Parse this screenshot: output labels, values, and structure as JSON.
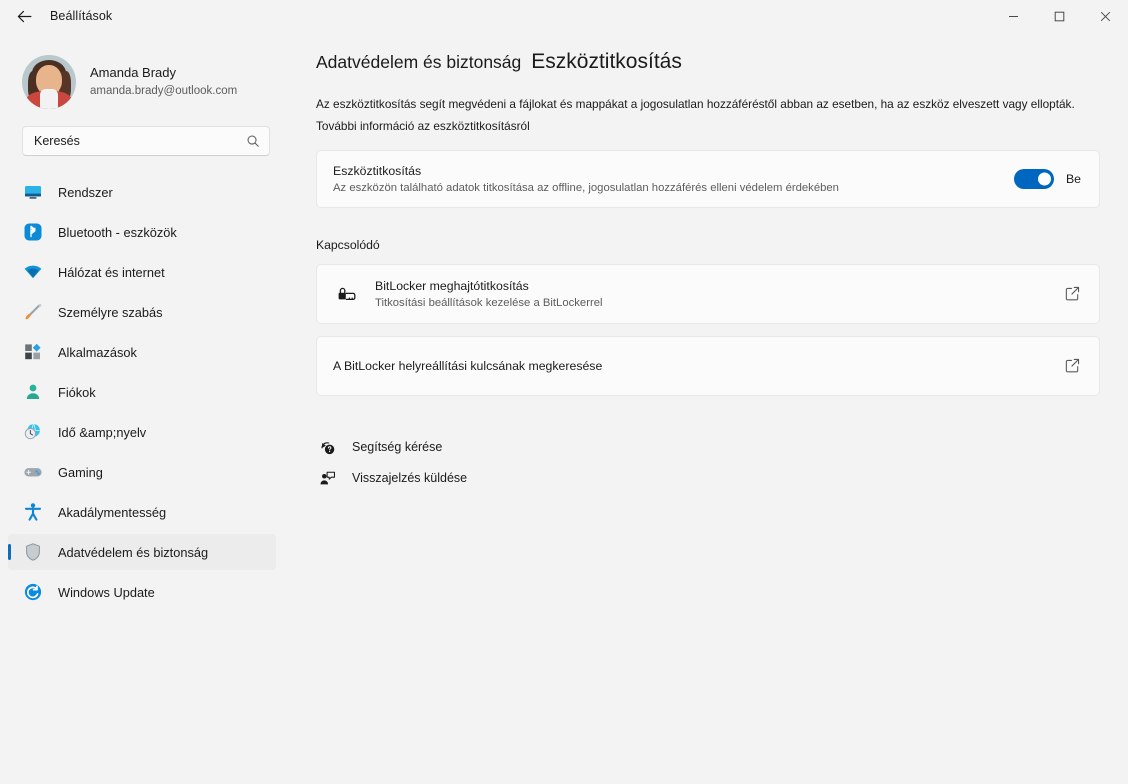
{
  "window": {
    "title": "Beállítások",
    "back_icon": "back-arrow-icon",
    "minimize_label": "–",
    "maximize_label": "□",
    "close_label": "✕"
  },
  "account": {
    "name": "Amanda Brady",
    "email": "amanda.brady@outlook.com",
    "avatar_icon": "user-avatar-photo"
  },
  "search": {
    "placeholder": "Keresés",
    "value": "",
    "icon": "search-icon"
  },
  "sidebar": {
    "items": [
      {
        "label": "Rendszer",
        "icon": "monitor-icon",
        "selected": false
      },
      {
        "label": "Bluetooth - eszközök",
        "icon": "bluetooth-icon",
        "selected": false
      },
      {
        "label": "Hálózat és internet",
        "icon": "wifi-icon",
        "selected": false
      },
      {
        "label": "Személyre szabás",
        "icon": "paintbrush-icon",
        "selected": false
      },
      {
        "label": "Alkalmazások",
        "icon": "apps-icon",
        "selected": false
      },
      {
        "label": "Fiókok",
        "icon": "accounts-person-icon",
        "selected": false
      },
      {
        "label": "Idő &amp;nyelv",
        "icon": "clock-globe-icon",
        "selected": false
      },
      {
        "label": "Gaming",
        "icon": "gamepad-icon",
        "selected": false
      },
      {
        "label": "Akadálymentesség",
        "icon": "accessibility-icon",
        "selected": false
      },
      {
        "label": "Adatvédelem és biztonság",
        "icon": "shield-icon",
        "selected": true
      },
      {
        "label": "Windows Update",
        "icon": "update-refresh-icon",
        "selected": false
      }
    ]
  },
  "main": {
    "breadcrumb_parent": "Adatvédelem és biztonság",
    "breadcrumb_current": "Eszköztitkosítás",
    "description": "Az eszköztitkosítás segít megvédeni a fájlokat és mappákat a jogosulatlan hozzáféréstől abban az esetben, ha az eszköz elveszett vagy ellopták. További információ az eszköztitkosításról",
    "device_encryption": {
      "title": "Eszköztitkosítás",
      "subtitle": "Az eszközön található adatok titkosítása az offline, jogosulatlan hozzáférés elleni védelem érdekében",
      "toggle_state_label": "Be",
      "toggle_on": true,
      "toggle_color": "#0067c0"
    },
    "related_label": "Kapcsolódó",
    "related_items": [
      {
        "title": "BitLocker meghajtótitkosítás",
        "subtitle": "Titkosítási beállítások kezelése a BitLockerrel",
        "icon": "bitlocker-drive-lock-icon",
        "action_icon": "external-link-icon"
      },
      {
        "title": "A BitLocker helyreállítási kulcsának megkeresése",
        "subtitle": "",
        "icon": "",
        "action_icon": "external-link-icon"
      }
    ],
    "footer_links": [
      {
        "label": "Segítség kérése",
        "icon": "help-question-icon"
      },
      {
        "label": "Visszajelzés küldése",
        "icon": "feedback-icon"
      }
    ]
  },
  "theme": {
    "accent": "#0067c0",
    "selection_bar": "#0f6cbd",
    "page_bg": "#f3f3f3",
    "card_bg": "#fbfbfb"
  }
}
